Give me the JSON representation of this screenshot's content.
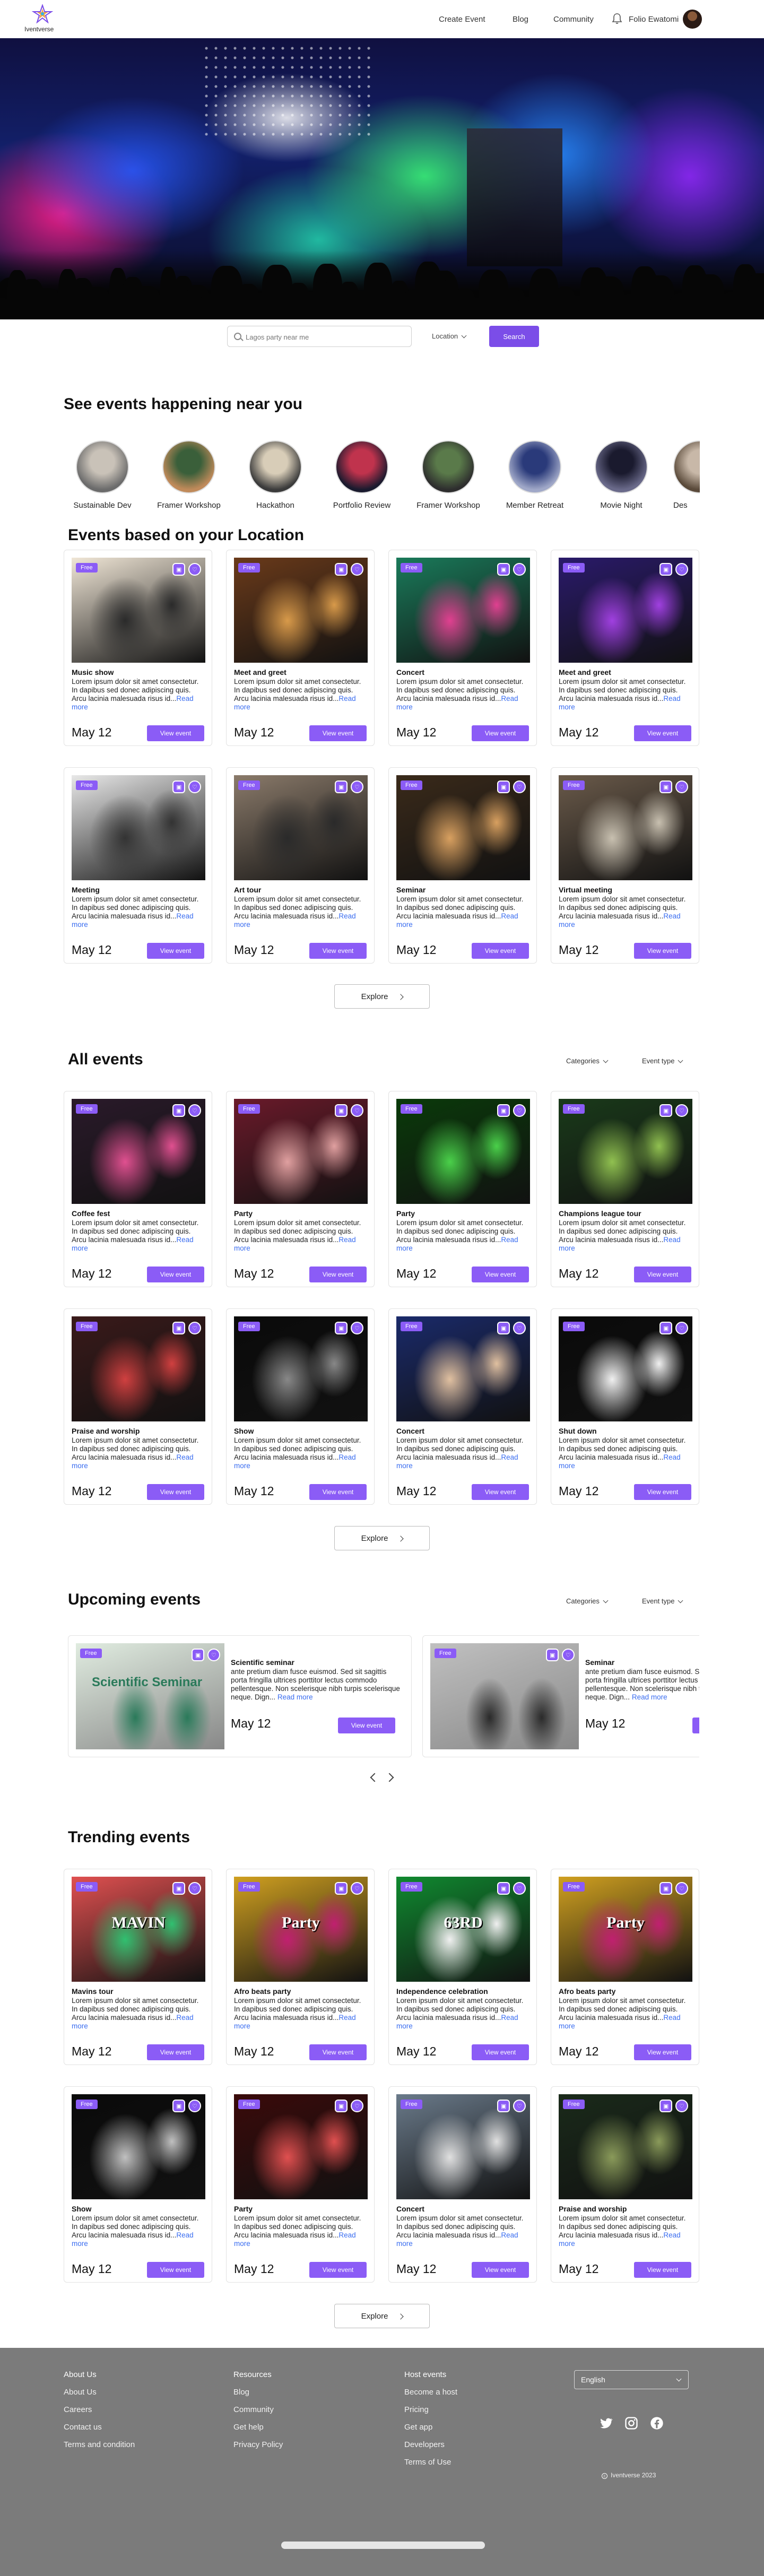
{
  "header": {
    "logo_text": "Iventverse",
    "nav": [
      "Create Event",
      "Blog",
      "Community"
    ],
    "user_name": "Folio Ewatomi"
  },
  "search": {
    "placeholder": "Lagos party near me",
    "location_label": "Location",
    "button_label": "Search"
  },
  "categories": {
    "title": "See events happening near you",
    "items": [
      "Sustainable Dev",
      "Framer Workshop",
      "Hackathon",
      "Portfolio Review",
      "Framer Workshop",
      "Member Retreat",
      "Movie Night",
      "Des"
    ]
  },
  "location_section": {
    "title": "Events based on your Location",
    "explore_label": "Explore",
    "cards": [
      {
        "badge": "Free",
        "title": "Music show",
        "desc": "Lorem ipsum dolor sit amet consectetur. In dapibus sed donec adipiscing quis. Arcu lacinia malesuada risus id...",
        "more": "Read more",
        "date": "May 12",
        "button": "View event"
      },
      {
        "badge": "Free",
        "title": "Meet and greet",
        "desc": "Lorem ipsum dolor sit amet consectetur. In dapibus sed donec adipiscing quis. Arcu lacinia malesuada risus id...",
        "more": "Read more",
        "date": "May 12",
        "button": "View event"
      },
      {
        "badge": "Free",
        "title": "Concert",
        "desc": "Lorem ipsum dolor sit amet consectetur. In dapibus sed donec adipiscing quis. Arcu lacinia malesuada risus id...",
        "more": "Read more",
        "date": "May 12",
        "button": "View event"
      },
      {
        "badge": "Free",
        "title": "Meet and greet",
        "desc": "Lorem ipsum dolor sit amet consectetur. In dapibus sed donec adipiscing quis. Arcu lacinia malesuada risus id...",
        "more": "Read more",
        "date": "May 12",
        "button": "View event"
      },
      {
        "badge": "Free",
        "title": "Meeting",
        "desc": "Lorem ipsum dolor sit amet consectetur. In dapibus sed donec adipiscing quis. Arcu lacinia malesuada risus id...",
        "more": "Read more",
        "date": "May 12",
        "button": "View event"
      },
      {
        "badge": "Free",
        "title": "Art tour",
        "desc": "Lorem ipsum dolor sit amet consectetur. In dapibus sed donec adipiscing quis. Arcu lacinia malesuada risus id...",
        "more": "Read more",
        "date": "May 12",
        "button": "View event"
      },
      {
        "badge": "Free",
        "title": "Seminar",
        "desc": "Lorem ipsum dolor sit amet consectetur. In dapibus sed donec adipiscing quis. Arcu lacinia malesuada risus id...",
        "more": "Read more",
        "date": "May 12",
        "button": "View event"
      },
      {
        "badge": "Free",
        "title": "Virtual meeting",
        "desc": "Lorem ipsum dolor sit amet consectetur. In dapibus sed donec adipiscing quis. Arcu lacinia malesuada risus id...",
        "more": "Read more",
        "date": "May 12",
        "button": "View event"
      }
    ]
  },
  "all_section": {
    "title": "All events",
    "filter_categories": "Categories",
    "filter_type": "Event type",
    "explore_label": "Explore",
    "cards": [
      {
        "badge": "Free",
        "title": "Coffee fest",
        "desc": "Lorem ipsum dolor sit amet consectetur. In dapibus sed donec adipiscing quis. Arcu lacinia malesuada risus id...",
        "more": "Read more",
        "date": "May 12",
        "button": "View event"
      },
      {
        "badge": "Free",
        "title": "Party",
        "desc": "Lorem ipsum dolor sit amet consectetur. In dapibus sed donec adipiscing quis. Arcu lacinia malesuada risus id...",
        "more": "Read more",
        "date": "May 12",
        "button": "View event"
      },
      {
        "badge": "Free",
        "title": "Party",
        "desc": "Lorem ipsum dolor sit amet consectetur. In dapibus sed donec adipiscing quis. Arcu lacinia malesuada risus id...",
        "more": "Read more",
        "date": "May 12",
        "button": "View event"
      },
      {
        "badge": "Free",
        "title": "Champions league tour",
        "desc": "Lorem ipsum dolor sit amet consectetur. In dapibus sed donec adipiscing quis. Arcu lacinia malesuada risus id...",
        "more": "Read more",
        "date": "May 12",
        "button": "View event"
      },
      {
        "badge": "Free",
        "title": "Praise and worship",
        "desc": "Lorem ipsum dolor sit amet consectetur. In dapibus sed donec adipiscing quis. Arcu lacinia malesuada risus id...",
        "more": "Read more",
        "date": "May 12",
        "button": "View event"
      },
      {
        "badge": "Free",
        "title": "Show",
        "desc": "Lorem ipsum dolor sit amet consectetur. In dapibus sed donec adipiscing quis. Arcu lacinia malesuada risus id...",
        "more": "Read more",
        "date": "May 12",
        "button": "View event"
      },
      {
        "badge": "Free",
        "title": "Concert",
        "desc": "Lorem ipsum dolor sit amet consectetur. In dapibus sed donec adipiscing quis. Arcu lacinia malesuada risus id...",
        "more": "Read more",
        "date": "May 12",
        "button": "View event"
      },
      {
        "badge": "Free",
        "title": "Shut down",
        "desc": "Lorem ipsum dolor sit amet consectetur. In dapibus sed donec adipiscing quis. Arcu lacinia malesuada risus id...",
        "more": "Read more",
        "date": "May 12",
        "button": "View event"
      }
    ]
  },
  "upcoming_section": {
    "title": "Upcoming events",
    "filter_categories": "Categories",
    "filter_type": "Event type",
    "cards": [
      {
        "badge": "Free",
        "title": "Scientific seminar",
        "desc": "ante pretium diam fusce euismod. Sed sit sagittis porta fringilla ultrices porttitor lectus commodo pellentesque. Non scelerisque nibh turpis scelerisque neque. Dign...",
        "more": "Read more",
        "date": "May 12",
        "button": "View event",
        "image_text": "Scientific Seminar"
      },
      {
        "badge": "Free",
        "title": "Seminar",
        "desc": "ante pretium diam fusce euismod. Sed sit sagittis porta fringilla ultrices porttitor lectus commodo pellentesque. Non scelerisque nibh turpis scelerisque neque. Dign...",
        "more": "Read more",
        "date": "May 12",
        "button": "View event"
      }
    ]
  },
  "trending_section": {
    "title": "Trending events",
    "explore_label": "Explore",
    "cards": [
      {
        "badge": "Free",
        "title": "Mavins tour",
        "desc": "Lorem ipsum dolor sit amet consectetur. In dapibus sed donec adipiscing quis. Arcu lacinia malesuada risus id...",
        "more": "Read more",
        "date": "May 12",
        "button": "View event",
        "image_text": "MAVIN"
      },
      {
        "badge": "Free",
        "title": "Afro beats party",
        "desc": "Lorem ipsum dolor sit amet consectetur. In dapibus sed donec adipiscing quis. Arcu lacinia malesuada risus id...",
        "more": "Read more",
        "date": "May 12",
        "button": "View event",
        "image_text": "Party"
      },
      {
        "badge": "Free",
        "title": "Independence celebration",
        "desc": "Lorem ipsum dolor sit amet consectetur. In dapibus sed donec adipiscing quis. Arcu lacinia malesuada risus id...",
        "more": "Read more",
        "date": "May 12",
        "button": "View event",
        "image_text": "63RD"
      },
      {
        "badge": "Free",
        "title": "Afro beats party",
        "desc": "Lorem ipsum dolor sit amet consectetur. In dapibus sed donec adipiscing quis. Arcu lacinia malesuada risus id...",
        "more": "Read more",
        "date": "May 12",
        "button": "View event",
        "image_text": "Party"
      },
      {
        "badge": "Free",
        "title": "Show",
        "desc": "Lorem ipsum dolor sit amet consectetur. In dapibus sed donec adipiscing quis. Arcu lacinia malesuada risus id...",
        "more": "Read more",
        "date": "May 12",
        "button": "View event"
      },
      {
        "badge": "Free",
        "title": "Party",
        "desc": "Lorem ipsum dolor sit amet consectetur. In dapibus sed donec adipiscing quis. Arcu lacinia malesuada risus id...",
        "more": "Read more",
        "date": "May 12",
        "button": "View event"
      },
      {
        "badge": "Free",
        "title": "Concert",
        "desc": "Lorem ipsum dolor sit amet consectetur. In dapibus sed donec adipiscing quis. Arcu lacinia malesuada risus id...",
        "more": "Read more",
        "date": "May 12",
        "button": "View event"
      },
      {
        "badge": "Free",
        "title": "Praise and worship",
        "desc": "Lorem ipsum dolor sit amet consectetur. In dapibus sed donec adipiscing quis. Arcu lacinia malesuada risus id...",
        "more": "Read more",
        "date": "May 12",
        "button": "View event"
      }
    ]
  },
  "footer": {
    "col1": {
      "heading": "About Us",
      "links": [
        "About Us",
        "Careers",
        "Contact us",
        "Terms and condition"
      ]
    },
    "col2": {
      "heading": "Resources",
      "links": [
        "Blog",
        "Community",
        "Get help",
        "Privacy Policy"
      ]
    },
    "col3": {
      "heading": "Host events",
      "links": [
        "Become a host",
        "Pricing",
        "Get app",
        "Developers",
        "Terms of Use"
      ]
    },
    "language": "English",
    "social": [
      "twitter-icon",
      "instagram-icon",
      "facebook-icon"
    ],
    "copyright": "Iventverse 2023"
  },
  "colors": {
    "accent": "#8b5cf6",
    "link": "#3a6df0",
    "footer_bg": "#7b7b7b"
  }
}
